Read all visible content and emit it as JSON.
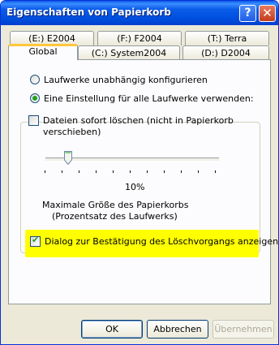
{
  "window": {
    "title": "Eigenschaften von Papierkorb",
    "help_label": "?",
    "close_label": "✕"
  },
  "tabs": {
    "row1": [
      "(E:) E2004",
      "(F:) F2004",
      "(T:) Terra"
    ],
    "row2": [
      "Global",
      "(C:) System2004",
      "(D:) D2004"
    ],
    "active": "Global"
  },
  "options": {
    "radio_independent": "Laufwerke unabhängig konfigurieren",
    "radio_one_setting": "Eine Einstellung für alle Laufwerke verwenden:",
    "radio_selected": "radio_one_setting",
    "delete_immediately_line1": "Dateien sofort löschen (nicht in Papierkorb",
    "delete_immediately_line2": "verschieben)",
    "delete_immediately_checked": false,
    "slider_value": "10%",
    "slider_fraction": 0.1,
    "max_size_line1": "Maximale Größe des Papierkorbs",
    "max_size_line2": "(Prozentsatz des Laufwerks)",
    "confirm_dialog": "Dialog zur Bestätigung des Löschvorgangs anzeigen",
    "confirm_dialog_checked": true
  },
  "buttons": {
    "ok": "OK",
    "cancel": "Abbrechen",
    "apply": "Übernehmen"
  },
  "colors": {
    "titlebar": "#0a5ce8",
    "highlight": "#ffff00",
    "check": "#21a121"
  }
}
